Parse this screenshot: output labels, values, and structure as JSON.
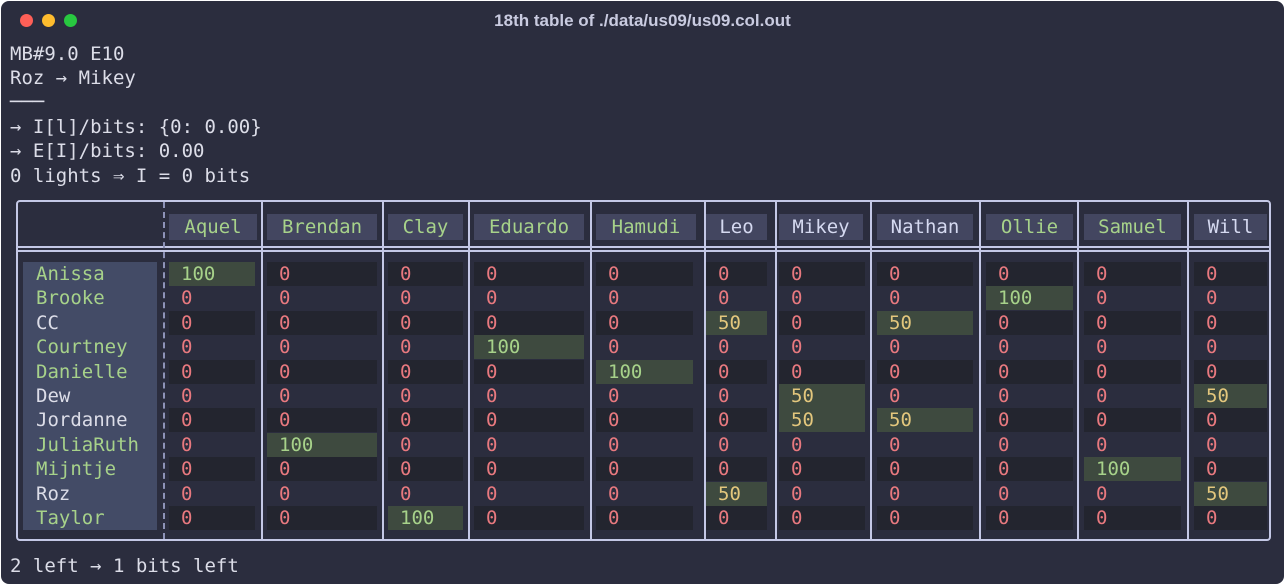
{
  "window": {
    "title": "18th table of ./data/us09/us09.col.out"
  },
  "header_lines": [
    "MB#9.0 E10",
    "Roz → Mikey",
    "───",
    "→ I[l]/bits: {0: 0.00}",
    "→ E[I]/bits: 0.00",
    "0 lights ⇒ I = 0 bits"
  ],
  "footer": "2 left → 1 bits left",
  "table": {
    "columns": [
      "Aquel",
      "Brendan",
      "Clay",
      "Eduardo",
      "Hamudi",
      "Leo",
      "Mikey",
      "Nathan",
      "Ollie",
      "Samuel",
      "Will"
    ],
    "rows": [
      {
        "name": "Anissa",
        "values": [
          "100",
          "0",
          "0",
          "0",
          "0",
          "0",
          "0",
          "0",
          "0",
          "0",
          "0"
        ]
      },
      {
        "name": "Brooke",
        "values": [
          "0",
          "0",
          "0",
          "0",
          "0",
          "0",
          "0",
          "0",
          "100",
          "0",
          "0"
        ]
      },
      {
        "name": "CC",
        "values": [
          "0",
          "0",
          "0",
          "0",
          "0",
          "50",
          "0",
          "50",
          "0",
          "0",
          "0"
        ]
      },
      {
        "name": "Courtney",
        "values": [
          "0",
          "0",
          "0",
          "100",
          "0",
          "0",
          "0",
          "0",
          "0",
          "0",
          "0"
        ]
      },
      {
        "name": "Danielle",
        "values": [
          "0",
          "0",
          "0",
          "0",
          "100",
          "0",
          "0",
          "0",
          "0",
          "0",
          "0"
        ]
      },
      {
        "name": "Dew",
        "values": [
          "0",
          "0",
          "0",
          "0",
          "0",
          "0",
          "50",
          "0",
          "0",
          "0",
          "50"
        ]
      },
      {
        "name": "Jordanne",
        "values": [
          "0",
          "0",
          "0",
          "0",
          "0",
          "0",
          "50",
          "50",
          "0",
          "0",
          "0"
        ]
      },
      {
        "name": "JuliaRuth",
        "values": [
          "0",
          "100",
          "0",
          "0",
          "0",
          "0",
          "0",
          "0",
          "0",
          "0",
          "0"
        ]
      },
      {
        "name": "Mijntje",
        "values": [
          "0",
          "0",
          "0",
          "0",
          "0",
          "0",
          "0",
          "0",
          "0",
          "100",
          "0"
        ]
      },
      {
        "name": "Roz",
        "values": [
          "0",
          "0",
          "0",
          "0",
          "0",
          "50",
          "0",
          "0",
          "0",
          "0",
          "50"
        ]
      },
      {
        "name": "Taylor",
        "values": [
          "0",
          "0",
          "100",
          "0",
          "0",
          "0",
          "0",
          "0",
          "0",
          "0",
          "0"
        ]
      }
    ]
  },
  "colors": {
    "background": "#2b2d3e",
    "green_text": "#a7d28a",
    "red_text": "#e8797f",
    "yellow_text": "#e3c77d",
    "highlight_bg": "#3e4a3f",
    "border": "#c4c8e6"
  },
  "icons": [
    "close-dot",
    "minimize-dot",
    "maximize-dot"
  ]
}
